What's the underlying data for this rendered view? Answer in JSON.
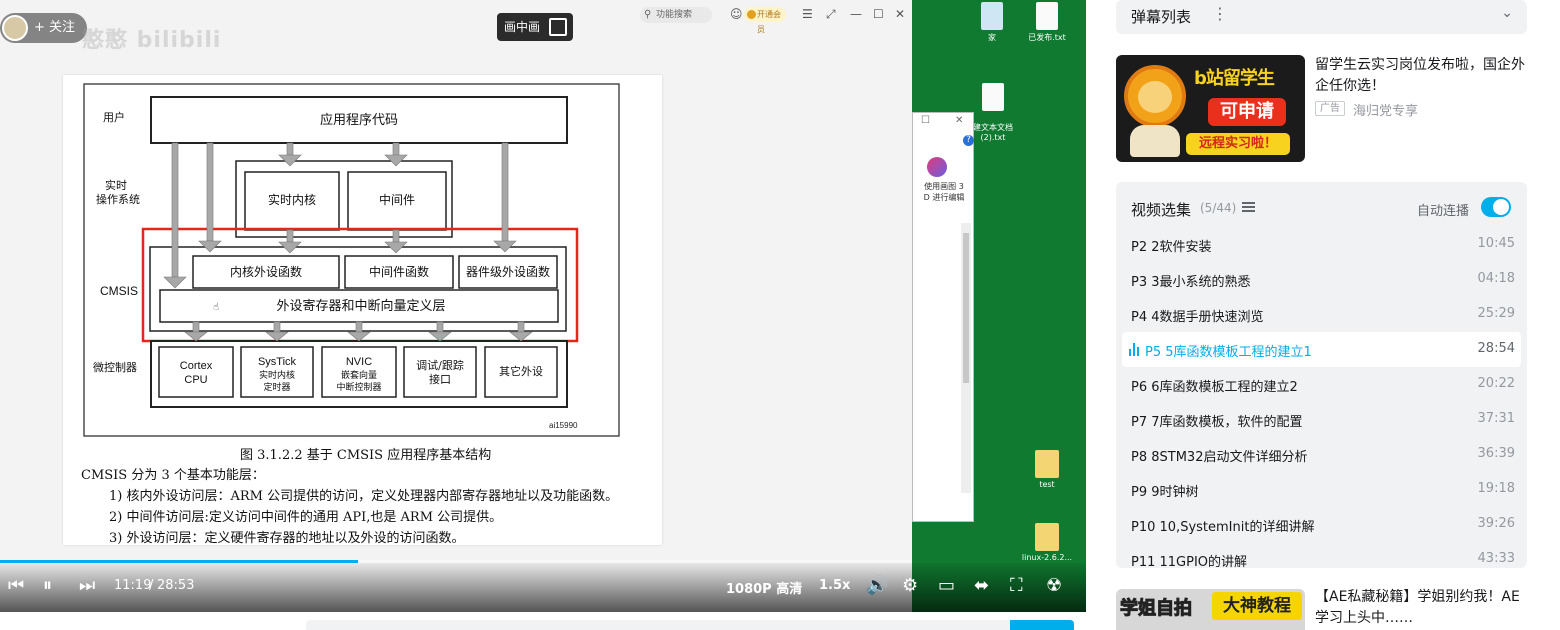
{
  "player": {
    "follow_label": "+ 关注",
    "watermark": "憨憨 bilibili",
    "pip_label": "画中画",
    "viewer_search_placeholder": "功能搜索",
    "vip_label": "开通会员",
    "time_current": "11:19",
    "time_separator": "/",
    "time_total": "28:53",
    "progress": 0.392,
    "quality": "1080P 高清",
    "speed": "1.5x"
  },
  "document": {
    "diagram": {
      "row_labels": [
        "用户",
        "实时\n操作系统",
        "CMSIS",
        "微控制器"
      ],
      "app_code": "应用程序代码",
      "rtos_kernel": "实时内核",
      "middleware": "中间件",
      "core_periph_funcs": "内核外设函数",
      "middleware_funcs": "中间件函数",
      "device_periph_funcs": "器件级外设函数",
      "periph_reg_layer": "外设寄存器和中断向量定义层",
      "mcu_blocks": [
        {
          "line1": "Cortex",
          "line2": "CPU"
        },
        {
          "line1": "SysTick",
          "line2": "实时内核",
          "line3": "定时器"
        },
        {
          "line1": "NVIC",
          "line2": "嵌套向量",
          "line3": "中断控制器"
        },
        {
          "line1": "调试/跟踪",
          "line2": "接口"
        },
        {
          "line1": "其它外设"
        }
      ],
      "figure_id": "ai15990"
    },
    "caption": "图 3.1.2.2  基于 CMSIS 应用程序基本结构",
    "body_lines": [
      "CMSIS 分为 3 个基本功能层：",
      "1) 核内外设访问层：ARM 公司提供的访问，定义处理器内部寄存器地址以及功能函数。",
      "2) 中间件访问层:定义访问中间件的通用 API,也是 ARM 公司提供。",
      "3) 外设访问层：定义硬件寄存器的地址以及外设的访问函数。"
    ]
  },
  "desktop": {
    "icons": [
      {
        "label": "家"
      },
      {
        "label": "已发布.txt"
      },
      {
        "label": "建文本文档\n(2).txt"
      },
      {
        "label": "test"
      },
      {
        "label": "linux-2.6.2..."
      }
    ],
    "paint_window_caption": "使用画图 3\nD 进行编辑"
  },
  "sidebar": {
    "danmaku_title": "弹幕列表",
    "ad": {
      "thumb_line1": "b站留学生",
      "thumb_line2": "可申请",
      "thumb_line3": "远程实习啦！",
      "title": "留学生云实习岗位发布啦，国企外企任你选！",
      "tag": "广告",
      "source": "海归党专享"
    },
    "playlist": {
      "title": "视频选集",
      "count": "(5/44)",
      "autoplay_label": "自动连播",
      "autoplay_on": true,
      "episodes": [
        {
          "label": "P2   2软件安装",
          "duration": "10:45",
          "active": false
        },
        {
          "label": "P3   3最小系统的熟悉",
          "duration": "04:18",
          "active": false
        },
        {
          "label": "P4   4数据手册快速浏览",
          "duration": "25:29",
          "active": false
        },
        {
          "label": "P5   5库函数模板工程的建立1",
          "duration": "28:54",
          "active": true
        },
        {
          "label": "P6   6库函数模板工程的建立2",
          "duration": "20:22",
          "active": false
        },
        {
          "label": "P7   7库函数模板，软件的配置",
          "duration": "37:31",
          "active": false
        },
        {
          "label": "P8   8STM32启动文件详细分析",
          "duration": "36:39",
          "active": false
        },
        {
          "label": "P9   9时钟树",
          "duration": "19:18",
          "active": false
        },
        {
          "label": "P10   10,SystemInit的详细讲解",
          "duration": "39:26",
          "active": false
        },
        {
          "label": "P11   11GPIO的讲解",
          "duration": "43:33",
          "active": false
        }
      ]
    },
    "recommend": {
      "thumb_left": "学姐自拍",
      "thumb_right": "大神教程",
      "title": "【AE私藏秘籍】学姐别约我！AE学习上头中……"
    }
  },
  "colors": {
    "accent": "#00aeec",
    "desktop_green": "#0f7a30",
    "highlight_red": "#e5261a"
  }
}
